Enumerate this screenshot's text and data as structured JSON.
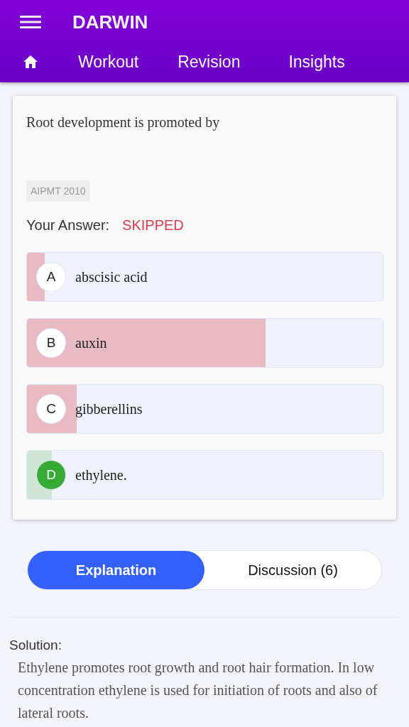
{
  "app_bar": {
    "title": "DARWIN"
  },
  "nav": [
    "Workout",
    "Revision",
    "Insights"
  ],
  "question": {
    "text": "Root development is promoted by",
    "tag": "AIPMT 2010",
    "answer_label": "Your Answer:",
    "answer_value": "SKIPPED"
  },
  "options": [
    {
      "letter": "A",
      "text": "abscisic acid",
      "level": 0.05,
      "correct": false
    },
    {
      "letter": "B",
      "text": "auxin",
      "level": 0.67,
      "correct": false
    },
    {
      "letter": "C",
      "text": "gibberellins",
      "level": 0.14,
      "correct": false
    },
    {
      "letter": "D",
      "text": "ethylene.",
      "level": 0.07,
      "correct": true
    }
  ],
  "tabs": [
    {
      "label": "Explanation",
      "selected": true
    },
    {
      "label": "Discussion (6)",
      "selected": false
    }
  ],
  "solution": {
    "heading": "Solution:",
    "text": "Ethylene promotes root growth and root hair formation. In low concentration ethylene is used for initiation of roots and also of lateral roots."
  }
}
